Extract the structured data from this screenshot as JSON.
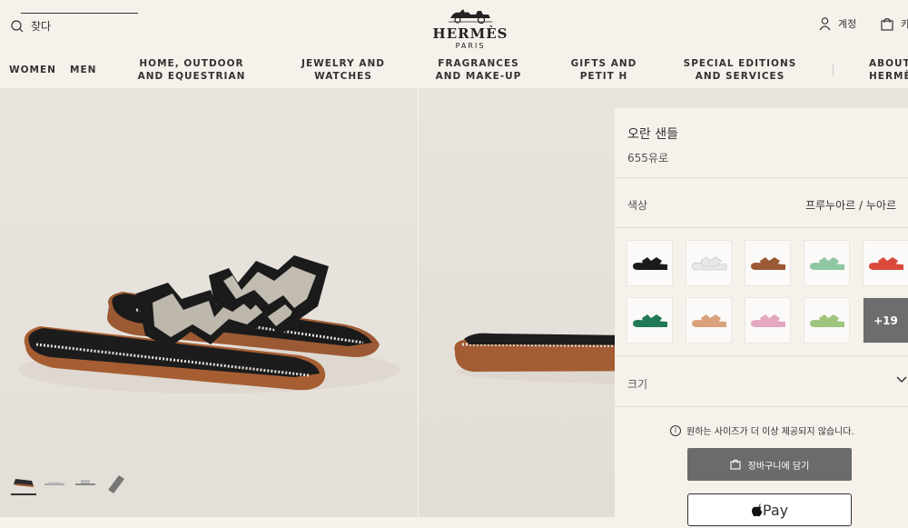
{
  "header": {
    "search_label": "찾다",
    "logo_word": "HERMÈS",
    "logo_city": "PARIS",
    "account_label": "계정",
    "cart_label": "카"
  },
  "nav": {
    "items": [
      {
        "label": "WOMEN"
      },
      {
        "label": "MEN"
      },
      {
        "label": "HOME, OUTDOOR AND EQUESTRIAN"
      },
      {
        "label": "JEWELRY AND WATCHES"
      },
      {
        "label": "FRAGRANCES AND MAKE-UP"
      },
      {
        "label": "GIFTS AND PETIT H"
      },
      {
        "label": "SPECIAL EDITIONS AND SERVICES"
      },
      {
        "label": "ABOUT HERMÈS"
      }
    ]
  },
  "product": {
    "title": "오란 샌들",
    "price": "655유로",
    "color_label": "색상",
    "color_value": "프루누아르 / 누아르",
    "swatch_colors": [
      "#1b1b1b",
      "#e8e8e8",
      "#9a5a34",
      "#8fc7a4",
      "#d94a3a",
      "#1f7a55",
      "#d9a27c",
      "#e3a7bf",
      "#9fc47e"
    ],
    "more_label": "+19",
    "size_label": "크기",
    "notice": "원하는 사이즈가 더 이상 제공되지 않습니다.",
    "add_to_cart": "장바구니에 담기",
    "pay_label": "Pay"
  },
  "colors": {
    "background": "#f6f1eb",
    "button_dark": "#6b6b6b"
  }
}
